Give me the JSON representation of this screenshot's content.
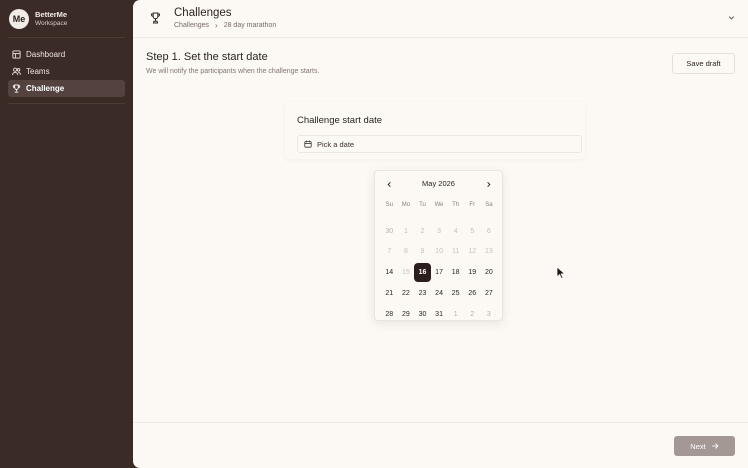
{
  "brand": {
    "logo": "Me",
    "name": "BetterMe",
    "workspace": "Workspace"
  },
  "sidebar": {
    "items": [
      {
        "label": "Dashboard",
        "icon": "dashboard-icon",
        "active": false
      },
      {
        "label": "Teams",
        "icon": "users-icon",
        "active": false
      },
      {
        "label": "Challenge",
        "icon": "trophy-icon",
        "active": true
      }
    ]
  },
  "header": {
    "title": "Challenges",
    "breadcrumb": [
      "Challenges",
      "28 day marathon"
    ]
  },
  "step": {
    "title": "Step 1. Set the start date",
    "description": "We will notify the participants when the challenge starts.",
    "save_draft": "Save draft"
  },
  "card": {
    "title": "Challenge start date",
    "placeholder": "Pick a date"
  },
  "calendar": {
    "month": "May 2026",
    "weekdays": [
      "Su",
      "Mo",
      "Tu",
      "We",
      "Th",
      "Fr",
      "Sa"
    ],
    "weeks": [
      [
        "30",
        "1",
        "2",
        "3",
        "4",
        "5",
        "6"
      ],
      [
        "7",
        "8",
        "9",
        "10",
        "11",
        "12",
        "13"
      ],
      [
        "14",
        "15",
        "16",
        "17",
        "18",
        "19",
        "20"
      ],
      [
        "21",
        "22",
        "23",
        "24",
        "25",
        "26",
        "27"
      ],
      [
        "28",
        "29",
        "30",
        "31",
        "1",
        "2",
        "3"
      ]
    ],
    "selected": "16"
  },
  "footer": {
    "next": "Next"
  },
  "colors": {
    "sidebar_bg": "#3b2b27",
    "main_bg": "#fcf9f5",
    "selected_day_bg": "#2a1f1c",
    "next_button_bg": "#a39894"
  }
}
